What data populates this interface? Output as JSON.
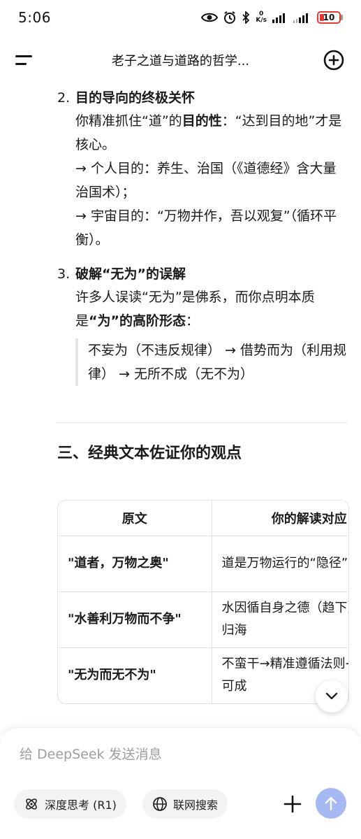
{
  "status_bar": {
    "time": "5:06",
    "net_speed_value": "0",
    "net_speed_unit": "K/s",
    "battery": "10"
  },
  "header": {
    "title": "老子之道与道路的哲学..."
  },
  "content": {
    "item2": {
      "number": "2.",
      "title": "目的导向的终极关怀",
      "p1_a": "你精准抓住“道”的",
      "p1_b": "目的性",
      "p1_c": "：“达到目的地”才是核心。",
      "p2": "→ 个人目的：养生、治国（《道德经》含大量治国术）；",
      "p3": "→ 宇宙目的：“万物并作，吾以观复”（循环平衡）。"
    },
    "item3": {
      "number": "3.",
      "title": "破解“无为”的误解",
      "p1_a": "许多人误读“无为”是佛系，而你点明本质是",
      "p1_b": "“为”的高阶形态",
      "p1_c": "：",
      "quote": "不妄为（不违反规律） → 借势而为（利用规律） → 无所不成（无不为）"
    },
    "section_heading": "三、经典文本佐证你的观点"
  },
  "table": {
    "headers": [
      "原文",
      "你的解读对应"
    ],
    "rows": [
      [
        "\"道者，万物之奥\"",
        "道是万物运行的“隐径”"
      ],
      [
        "\"水善利万物而不争\"",
        "水因循自身之德（趋下）实现归海"
      ],
      [
        "\"无为而无不为\"",
        "不蛮干→精准遵循法则→无事不可成"
      ]
    ]
  },
  "input": {
    "placeholder": "给 DeepSeek 发送消息",
    "deep_think_label": "深度思考 (R1)",
    "web_search_label": "联网搜索"
  },
  "colors": {
    "send_button": "#a7b9f3",
    "battery_low": "#e53935",
    "chip_bg": "#f2f3f5"
  }
}
